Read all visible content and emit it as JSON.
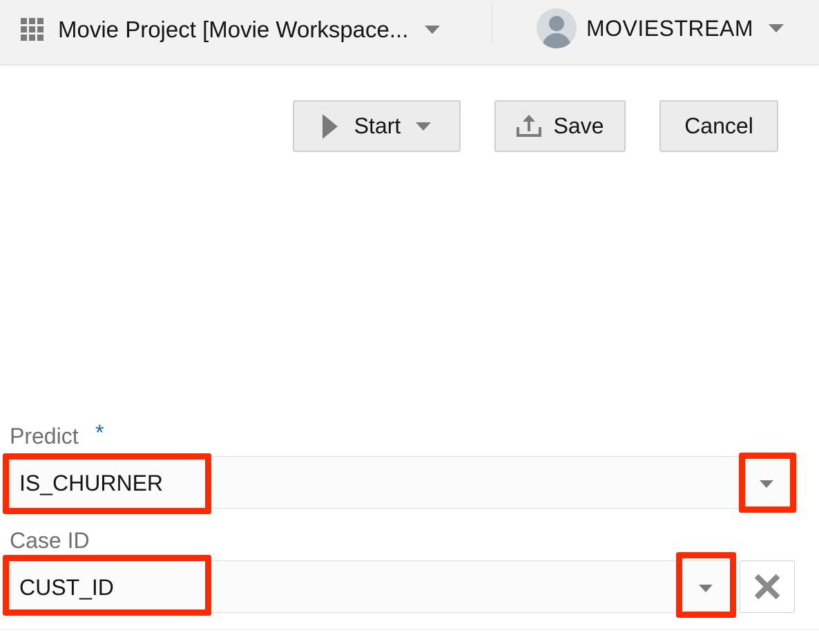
{
  "header": {
    "project_title": "Movie Project [Movie Workspace...",
    "user_name": "MOVIESTREAM"
  },
  "toolbar": {
    "start_label": "Start",
    "save_label": "Save",
    "cancel_label": "Cancel"
  },
  "form": {
    "predict": {
      "label": "Predict",
      "required_marker": "*",
      "value": "IS_CHURNER"
    },
    "case_id": {
      "label": "Case ID",
      "value": "CUST_ID"
    }
  },
  "colors": {
    "highlight": "#ff2a00",
    "required": "#1e6bb8",
    "header_bg": "#f2f2f2",
    "button_bg": "#ececec"
  },
  "icons": [
    "grid-icon",
    "chevron-down-icon",
    "avatar-icon",
    "play-icon",
    "upload-icon",
    "close-icon"
  ]
}
